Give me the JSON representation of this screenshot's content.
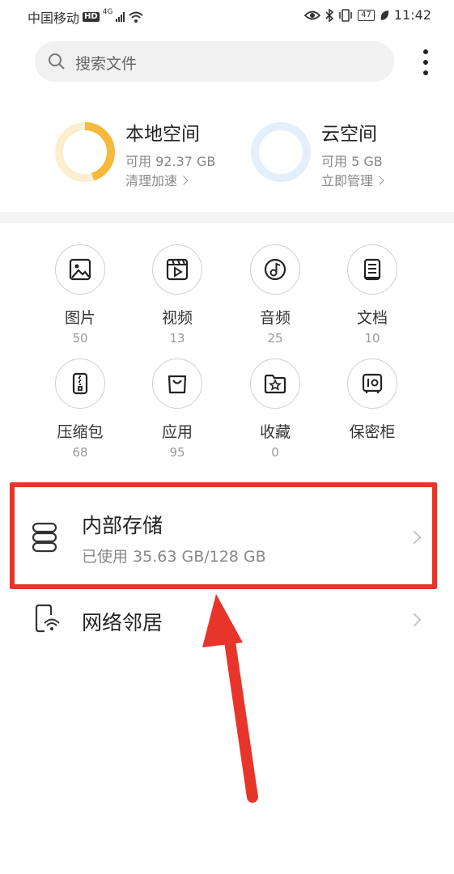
{
  "status_bar": {
    "carrier": "中国移动",
    "hd": "HD",
    "network": "4G",
    "battery": "47",
    "time": "11:42"
  },
  "search": {
    "placeholder": "搜索文件"
  },
  "storage": {
    "local": {
      "title": "本地空间",
      "available": "可用 92.37 GB",
      "action": "清理加速",
      "used_fraction": 0.45,
      "color": "#f6b93b"
    },
    "cloud": {
      "title": "云空间",
      "available": "可用 5 GB",
      "action": "立即管理",
      "used_fraction": 0.0,
      "color": "#d9ebfb"
    }
  },
  "categories": [
    {
      "label": "图片",
      "count": "50",
      "icon": "image-icon"
    },
    {
      "label": "视频",
      "count": "13",
      "icon": "video-icon"
    },
    {
      "label": "音频",
      "count": "25",
      "icon": "audio-icon"
    },
    {
      "label": "文档",
      "count": "10",
      "icon": "document-icon"
    },
    {
      "label": "压缩包",
      "count": "68",
      "icon": "archive-icon"
    },
    {
      "label": "应用",
      "count": "95",
      "icon": "app-bag-icon"
    },
    {
      "label": "收藏",
      "count": "0",
      "icon": "favorite-star-icon"
    },
    {
      "label": "保密柜",
      "count": "",
      "icon": "safe-icon"
    }
  ],
  "list": {
    "internal": {
      "title": "内部存储",
      "subtitle": "已使用 35.63 GB/128 GB"
    },
    "network": {
      "title": "网络邻居"
    }
  },
  "colors": {
    "highlight": "#e8352b",
    "arrow": "#e8352b"
  }
}
